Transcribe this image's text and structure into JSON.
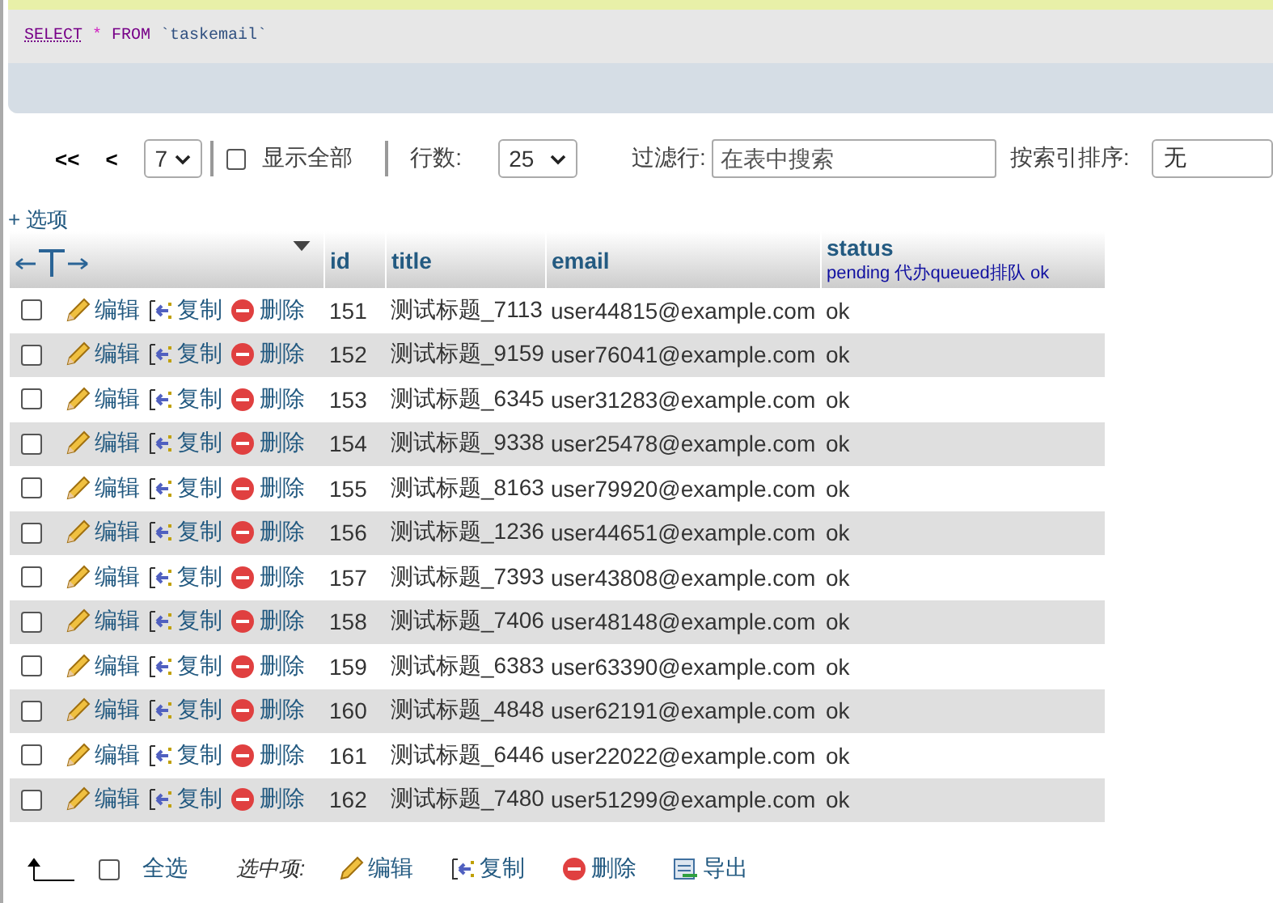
{
  "query": {
    "tokens": [
      {
        "kind": "keyword",
        "text": "SELECT"
      },
      {
        "kind": "operator",
        "text": "*"
      },
      {
        "kind": "keyword",
        "text": "FROM"
      },
      {
        "kind": "identifier",
        "text": "`taskemail`"
      }
    ]
  },
  "navigation": {
    "first": "<<",
    "previous": "<",
    "page": {
      "value": "7"
    },
    "show_all": {
      "label": "显示全部",
      "checked": false
    },
    "rows_label": "行数:",
    "rows": {
      "value": "25"
    },
    "filter_label": "过滤行:",
    "filter": {
      "placeholder": "在表中搜索"
    },
    "sort_label": "按索引排序:",
    "sort": {
      "value": "无"
    }
  },
  "options_link": "+ 选项",
  "table": {
    "columns": [
      {
        "label": "id"
      },
      {
        "label": "title"
      },
      {
        "label": "email"
      },
      {
        "label": "status",
        "comment": "pending 代办queued排队 ok"
      }
    ],
    "rows": [
      {
        "checked": false,
        "edit": "编辑",
        "copy": "复制",
        "delete": "删除",
        "id": "151",
        "title": "测试标题_7113",
        "email": "user44815@example.com",
        "status": "ok"
      },
      {
        "checked": false,
        "edit": "编辑",
        "copy": "复制",
        "delete": "删除",
        "id": "152",
        "title": "测试标题_9159",
        "email": "user76041@example.com",
        "status": "ok"
      },
      {
        "checked": false,
        "edit": "编辑",
        "copy": "复制",
        "delete": "删除",
        "id": "153",
        "title": "测试标题_6345",
        "email": "user31283@example.com",
        "status": "ok"
      },
      {
        "checked": false,
        "edit": "编辑",
        "copy": "复制",
        "delete": "删除",
        "id": "154",
        "title": "测试标题_9338",
        "email": "user25478@example.com",
        "status": "ok"
      },
      {
        "checked": false,
        "edit": "编辑",
        "copy": "复制",
        "delete": "删除",
        "id": "155",
        "title": "测试标题_8163",
        "email": "user79920@example.com",
        "status": "ok"
      },
      {
        "checked": false,
        "edit": "编辑",
        "copy": "复制",
        "delete": "删除",
        "id": "156",
        "title": "测试标题_1236",
        "email": "user44651@example.com",
        "status": "ok"
      },
      {
        "checked": false,
        "edit": "编辑",
        "copy": "复制",
        "delete": "删除",
        "id": "157",
        "title": "测试标题_7393",
        "email": "user43808@example.com",
        "status": "ok"
      },
      {
        "checked": false,
        "edit": "编辑",
        "copy": "复制",
        "delete": "删除",
        "id": "158",
        "title": "测试标题_7406",
        "email": "user48148@example.com",
        "status": "ok"
      },
      {
        "checked": false,
        "edit": "编辑",
        "copy": "复制",
        "delete": "删除",
        "id": "159",
        "title": "测试标题_6383",
        "email": "user63390@example.com",
        "status": "ok"
      },
      {
        "checked": false,
        "edit": "编辑",
        "copy": "复制",
        "delete": "删除",
        "id": "160",
        "title": "测试标题_4848",
        "email": "user62191@example.com",
        "status": "ok"
      },
      {
        "checked": false,
        "edit": "编辑",
        "copy": "复制",
        "delete": "删除",
        "id": "161",
        "title": "测试标题_6446",
        "email": "user22022@example.com",
        "status": "ok"
      },
      {
        "checked": false,
        "edit": "编辑",
        "copy": "复制",
        "delete": "删除",
        "id": "162",
        "title": "测试标题_7480",
        "email": "user51299@example.com",
        "status": "ok"
      }
    ]
  },
  "bulk": {
    "select_all": {
      "label": "全选",
      "checked": false
    },
    "with_selected": "选中项:",
    "actions": [
      {
        "kind": "edit",
        "label": "编辑"
      },
      {
        "kind": "copy",
        "label": "复制"
      },
      {
        "kind": "delete",
        "label": "删除"
      },
      {
        "kind": "export",
        "label": "导出"
      }
    ]
  }
}
